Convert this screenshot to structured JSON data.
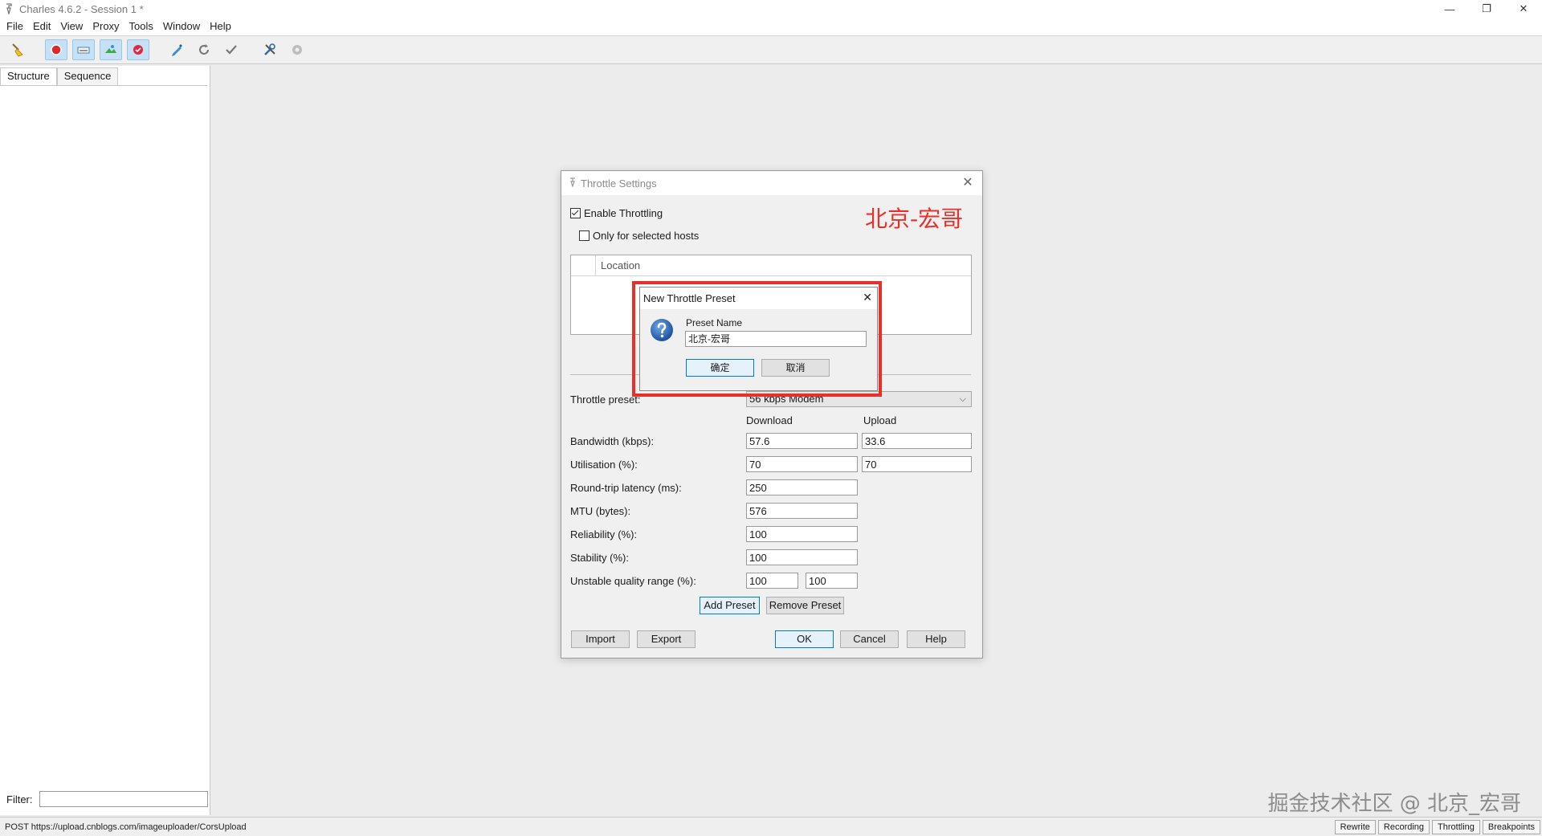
{
  "window": {
    "title": "Charles 4.6.2 - Session 1 *",
    "controls": {
      "minimize": "—",
      "restore": "❐",
      "close": "✕"
    }
  },
  "menubar": [
    "File",
    "Edit",
    "View",
    "Proxy",
    "Tools",
    "Window",
    "Help"
  ],
  "toolbar": {
    "icons": [
      "broom-icon",
      "record-icon",
      "throttle-icon",
      "map-icon",
      "breakpoint-icon",
      "compose-icon",
      "repeat-icon",
      "validate-icon",
      "tools-icon",
      "settings-icon"
    ]
  },
  "left_panel": {
    "tabs": [
      "Structure",
      "Sequence"
    ],
    "filter_label": "Filter:",
    "filter_value": ""
  },
  "statusbar": {
    "text": "POST https://upload.cnblogs.com/imageuploader/CorsUpload",
    "buttons": [
      "Rewrite",
      "Recording",
      "Throttling",
      "Breakpoints"
    ]
  },
  "watermark": "掘金技术社区 @ 北京_宏哥",
  "throttle_dialog": {
    "title": "Throttle Settings",
    "brand_text": "北京-宏哥",
    "enable_throttling": {
      "label": "Enable Throttling",
      "checked": true
    },
    "only_selected_hosts": {
      "label": "Only for selected hosts",
      "checked": false
    },
    "location_column": "Location",
    "preset_label": "Throttle preset:",
    "preset_value": "56 kbps Modem",
    "col_download": "Download",
    "col_upload": "Upload",
    "rows": [
      {
        "label": "Bandwidth (kbps):",
        "download": "57.6",
        "upload": "33.6"
      },
      {
        "label": "Utilisation (%):",
        "download": "70",
        "upload": "70"
      },
      {
        "label": "Round-trip latency (ms):",
        "download": "250"
      },
      {
        "label": "MTU (bytes):",
        "download": "576"
      },
      {
        "label": "Reliability (%):",
        "download": "100"
      },
      {
        "label": "Stability (%):",
        "download": "100"
      },
      {
        "label": "Unstable quality range (%):",
        "range_low": "100",
        "range_high": "100"
      }
    ],
    "buttons": {
      "add_preset": "Add Preset",
      "remove_preset": "Remove Preset",
      "import": "Import",
      "export": "Export",
      "ok": "OK",
      "cancel": "Cancel",
      "help": "Help"
    }
  },
  "preset_dialog": {
    "title": "New Throttle Preset",
    "field_label": "Preset Name",
    "field_value": "北京-宏哥",
    "ok": "确定",
    "cancel": "取消"
  },
  "colors": {
    "highlight": "#e8302a",
    "primary_border": "#0078d7"
  }
}
